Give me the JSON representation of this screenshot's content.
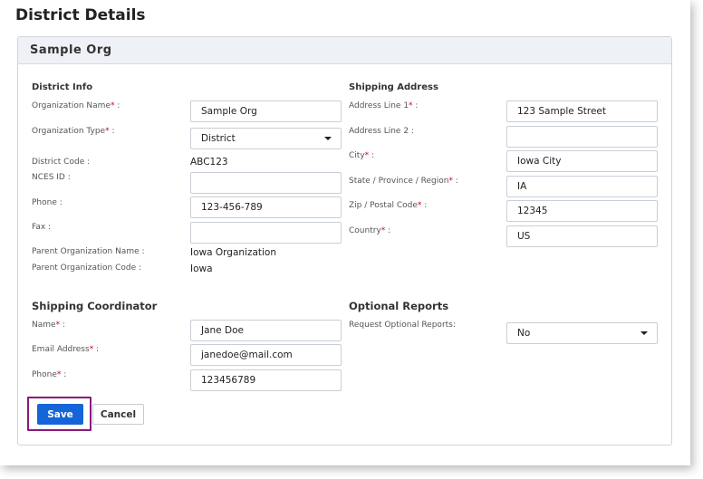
{
  "page": {
    "title": "District Details"
  },
  "card": {
    "title": "Sample Org"
  },
  "district_info": {
    "title": "District Info",
    "org_name": {
      "label": "Organization Name",
      "value": "Sample Org"
    },
    "org_type": {
      "label": "Organization Type",
      "value": "District"
    },
    "district_code": {
      "label": "District Code :",
      "value": "ABC123"
    },
    "nces_id": {
      "label": "NCES ID :",
      "value": ""
    },
    "phone": {
      "label": "Phone :",
      "value": "123-456-789"
    },
    "fax": {
      "label": "Fax :",
      "value": ""
    },
    "parent_org_name": {
      "label": "Parent Organization Name :",
      "value": "Iowa Organization"
    },
    "parent_org_code": {
      "label": "Parent Organization Code :",
      "value": "Iowa"
    }
  },
  "shipping_address": {
    "title": "Shipping Address",
    "address1": {
      "label": "Address Line 1",
      "value": "123 Sample Street"
    },
    "address2": {
      "label": "Address Line 2 :",
      "value": ""
    },
    "city": {
      "label": "City",
      "value": "Iowa City"
    },
    "state": {
      "label": "State / Province / Region",
      "value": "IA"
    },
    "zip": {
      "label": "Zip / Postal Code",
      "value": "12345"
    },
    "country": {
      "label": "Country",
      "value": "US"
    }
  },
  "shipping_coordinator": {
    "title": "Shipping Coordinator",
    "name": {
      "label": "Name",
      "value": "Jane Doe"
    },
    "email": {
      "label": "Email Address",
      "value": "janedoe@mail.com"
    },
    "phone": {
      "label": "Phone",
      "value": "123456789"
    }
  },
  "optional_reports": {
    "title": "Optional Reports",
    "request": {
      "label": "Request Optional Reports:",
      "value": "No"
    }
  },
  "required_marker": "*",
  "label_suffix": " :",
  "buttons": {
    "save": "Save",
    "cancel": "Cancel"
  },
  "colors": {
    "primary": "#1565d8",
    "required": "#d0021b",
    "highlight": "#8a1a7a"
  }
}
